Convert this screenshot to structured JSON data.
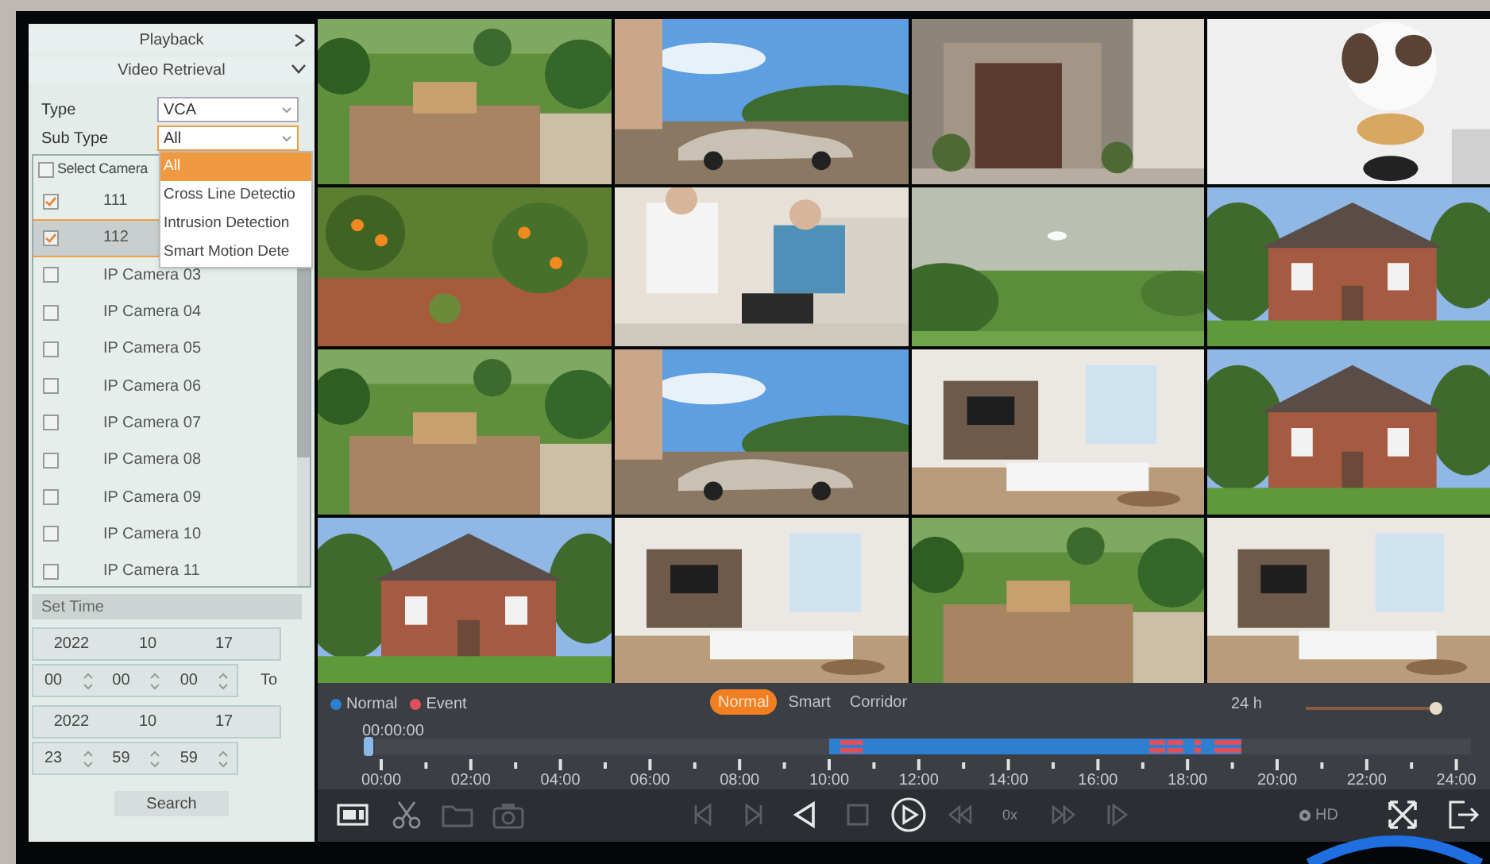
{
  "sidebar": {
    "sections": [
      {
        "title": "Playback",
        "expanded": false
      },
      {
        "title": "Video Retrieval",
        "expanded": true
      }
    ],
    "fields": [
      {
        "label": "Type",
        "value": "VCA",
        "focused": false
      },
      {
        "label": "Sub Type",
        "value": "All",
        "focused": true
      }
    ],
    "dropdown": {
      "options": [
        {
          "label": "All",
          "selected": true
        },
        {
          "label": "Cross Line Detectio",
          "selected": false
        },
        {
          "label": "Intrusion Detection",
          "selected": false
        },
        {
          "label": "Smart Motion Dete",
          "selected": false
        }
      ]
    },
    "camera_list": {
      "select_all": {
        "label": "Select Camera",
        "checked": false
      },
      "cameras": [
        {
          "name": "111",
          "checked": true,
          "selected": false
        },
        {
          "name": "112",
          "checked": true,
          "selected": true
        },
        {
          "name": "IP Camera 03",
          "checked": false,
          "selected": false
        },
        {
          "name": "IP Camera 04",
          "checked": false,
          "selected": false
        },
        {
          "name": "IP Camera 05",
          "checked": false,
          "selected": false
        },
        {
          "name": "IP Camera 06",
          "checked": false,
          "selected": false
        },
        {
          "name": "IP Camera 07",
          "checked": false,
          "selected": false
        },
        {
          "name": "IP Camera 08",
          "checked": false,
          "selected": false
        },
        {
          "name": "IP Camera 09",
          "checked": false,
          "selected": false
        },
        {
          "name": "IP Camera 10",
          "checked": false,
          "selected": false
        },
        {
          "name": "IP Camera 11",
          "checked": false,
          "selected": false
        }
      ]
    },
    "set_time": {
      "title": "Set Time",
      "start": {
        "date": [
          "2022",
          "10",
          "17"
        ],
        "time": [
          "00",
          "00",
          "00"
        ]
      },
      "to_label": "To",
      "end": {
        "date": [
          "2022",
          "10",
          "17"
        ],
        "time": [
          "23",
          "59",
          "59"
        ]
      }
    },
    "search_button": "Search"
  },
  "timeline": {
    "legend": [
      {
        "label": "Normal",
        "color": "#2f7fd0"
      },
      {
        "label": "Event",
        "color": "#e0505a"
      }
    ],
    "modes": [
      {
        "label": "Normal",
        "selected": true
      },
      {
        "label": "Smart",
        "selected": false
      },
      {
        "label": "Corridor",
        "selected": false
      }
    ],
    "zoom_label": "24 h",
    "zoom": {
      "level": 0.97
    },
    "current_time": "00:00:00",
    "hour_labels": [
      "00:00",
      "02:00",
      "04:00",
      "06:00",
      "08:00",
      "10:00",
      "12:00",
      "14:00",
      "16:00",
      "18:00",
      "20:00",
      "22:00",
      "24:00"
    ]
  },
  "toolbar": {
    "speed": "0x",
    "quality": "HD"
  }
}
